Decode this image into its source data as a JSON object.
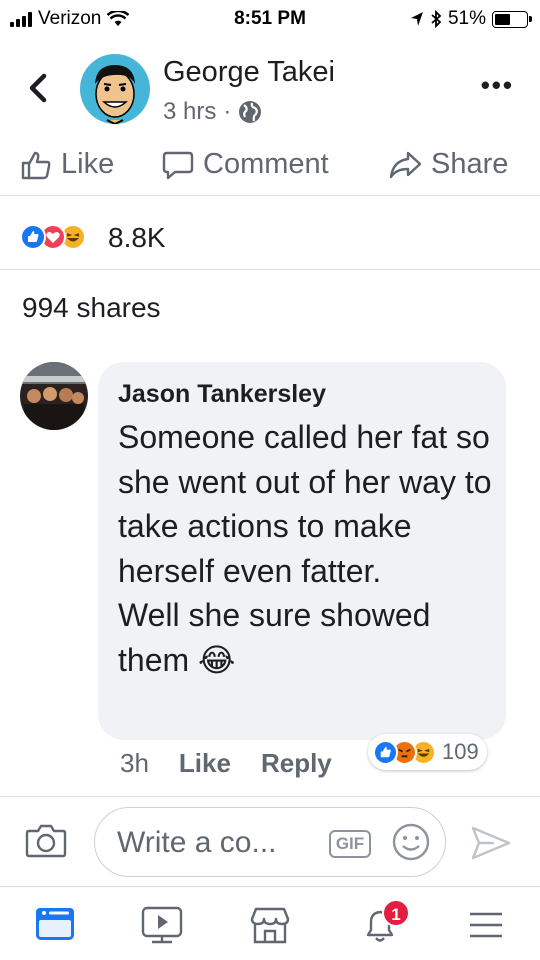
{
  "status_bar": {
    "carrier": "Verizon",
    "time": "8:51 PM",
    "battery": "51%",
    "battery_level": 0.51
  },
  "post": {
    "page_name": "George Takei",
    "time_ago": "3 hrs",
    "separator": "·",
    "actions": {
      "like": "Like",
      "comment": "Comment",
      "share": "Share"
    },
    "reaction_count": "8.8K",
    "shares": "994 shares"
  },
  "comment": {
    "author": "Jason Tankersley",
    "text": "Someone called her fat so she went out of her way to take actions to make herself even fatter.\nWell she sure showed them",
    "emoji": "😂",
    "time": "3h",
    "like": "Like",
    "reply": "Reply",
    "reaction_count": "109"
  },
  "composer": {
    "placeholder": "Write a co...",
    "gif_label": "GIF"
  },
  "tabbar": {
    "notification_badge": "1"
  },
  "colors": {
    "like_blue": "#1877f2",
    "love_red": "#f33e58",
    "haha_yellow": "#f7b125",
    "angry_orange": "#e9710f",
    "badge_red": "#e41e3f",
    "avatar_bg": "#46b6d8"
  }
}
